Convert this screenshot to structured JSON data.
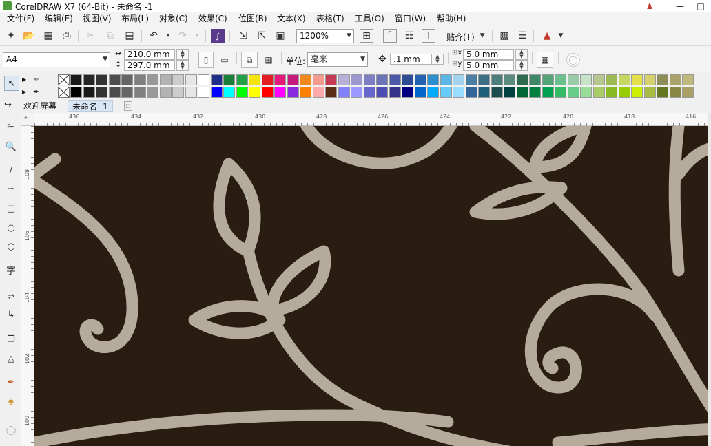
{
  "window": {
    "title": "CorelDRAW X7 (64-Bit) - 未命名 -1"
  },
  "menu": [
    "文件(F)",
    "编辑(E)",
    "视图(V)",
    "布局(L)",
    "对象(C)",
    "效果(C)",
    "位图(B)",
    "文本(X)",
    "表格(T)",
    "工具(O)",
    "窗口(W)",
    "帮助(H)"
  ],
  "toolbar": {
    "zoom_value": "1200%",
    "snap_label": "贴齐(T)"
  },
  "property_bar": {
    "page_size": "A4",
    "width": "210.0 mm",
    "height": "297.0 mm",
    "units_label": "单位:",
    "units_value": "毫米",
    "nudge_value": ".1 mm",
    "dup_x": "5.0 mm",
    "dup_y": "5.0 mm"
  },
  "palette_row1": [
    "#1a1a1a",
    "#262626",
    "#333333",
    "#4d4d4d",
    "#666666",
    "#808080",
    "#999999",
    "#b3b3b3",
    "#cccccc",
    "#e6e6e6",
    "#ffffff",
    "#1e2e8a",
    "#1a7d3a",
    "#22a048",
    "#f4e40b",
    "#e31d24",
    "#e6187a",
    "#c61b7c",
    "#f08a1e",
    "#f29a8c",
    "#c43a54",
    "#b7b1d9",
    "#9c97cf",
    "#7e7fc3",
    "#6a74b6",
    "#4c5aa8",
    "#2d4c94",
    "#2262b0",
    "#2c8ecf",
    "#5cb6e6",
    "#a4d3ee",
    "#4c7da3",
    "#3d6e85",
    "#4c7f7b",
    "#5c8c80",
    "#2e6a4f",
    "#3f8767",
    "#54a47a",
    "#6cbf8e",
    "#9acaa6",
    "#c6e3c9",
    "#b6c88f",
    "#9bba53",
    "#c6d662",
    "#e4e04b",
    "#d4d16e",
    "#8f8d57",
    "#a9a26a",
    "#bfba7c"
  ],
  "palette_row2": [
    "#000000",
    "#1a1a1a",
    "#333333",
    "#4d4d4d",
    "#666666",
    "#808080",
    "#999999",
    "#b3b3b3",
    "#cccccc",
    "#e6e6e6",
    "#ffffff",
    "#0000ff",
    "#00ffff",
    "#00ff00",
    "#ffff00",
    "#ff0000",
    "#ff00ff",
    "#8a2be2",
    "#ff8000",
    "#ffaaaa",
    "#5c2d16",
    "#8080ff",
    "#9999ff",
    "#6666cc",
    "#4d4db3",
    "#33338c",
    "#000080",
    "#0066cc",
    "#00aaff",
    "#66ccff",
    "#99ddff",
    "#336699",
    "#1f5f7a",
    "#1a4d4d",
    "#004040",
    "#006633",
    "#008040",
    "#00a050",
    "#33bb66",
    "#66cc88",
    "#99dd99",
    "#aacc66",
    "#88bb22",
    "#99cc00",
    "#ccee00",
    "#aabb44",
    "#667722",
    "#888844",
    "#aaa066"
  ],
  "tabs": [
    "欢迎屏幕",
    "未命名 -1"
  ],
  "ruler": {
    "h_ticks": [
      "436",
      "434",
      "432",
      "430",
      "428",
      "426",
      "424",
      "422",
      "420",
      "418",
      "416"
    ],
    "v_ticks": [
      "108",
      "106",
      "104",
      "102",
      "100"
    ]
  },
  "colors": {
    "canvas_bg": "#291c10",
    "pattern_stroke": "#b5ab9b"
  }
}
